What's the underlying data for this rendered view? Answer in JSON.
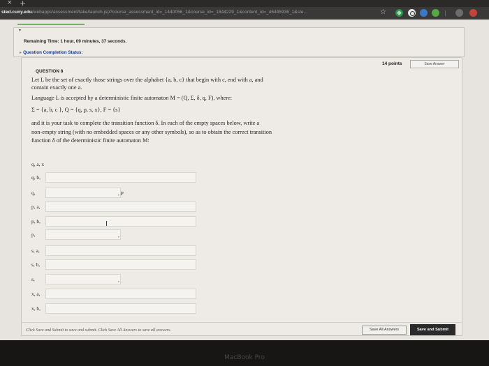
{
  "browser": {
    "tab_close_icon": "×",
    "new_tab_icon": "+",
    "url_host": "sted.cuny.edu",
    "url_path": "/webapps/assessment/take/launch.jsp?course_assessment_id=_1440056_1&course_id=_1844229_1&content_id=_46445936_1&ste...",
    "star_icon": "☆",
    "extension_icons": [
      "shield-check-icon",
      "circle-icon",
      "blue-extension-icon",
      "green-extension-icon",
      "profile-icon",
      "red-extension-icon"
    ]
  },
  "timer": {
    "label": "Remaining Time:",
    "value": "1 hour, 09 minutes, 37 seconds."
  },
  "completion_status": "Question Completion Status:",
  "question": {
    "heading": "QUESTION 8",
    "points": "14 points",
    "save_answer": "Save Answer",
    "line1": "Let L be the set of exactly those strings over the alphabet {a, b, c} that begin with  c,  end with a,  and",
    "line2": "contain exactly one    a.",
    "line3": "Language L is accepted by a deterministic finite automaton M = (Q, Σ, δ, q, F),  where:",
    "line4": "Σ = {a, b, c },  Q = {q, p, s, x},   F = {s}",
    "line5": "and it is your task to complete the transition function  δ.  In each of the empty spaces below, write a",
    "line6": "non-empty string (with no embedded spaces or any other symbols), so as to obtain the correct transition",
    "line7": "function  δ of the deterministic finite automaton M:",
    "transitions": [
      {
        "label": "q, a, x",
        "field": "none"
      },
      {
        "label": "q, b,",
        "field": "wide",
        "value": ""
      },
      {
        "label": "q,",
        "field": "narrow",
        "value": "",
        "extra": ", P"
      },
      {
        "label": "p, a,",
        "field": "wide",
        "value": ""
      },
      {
        "label": "p, b,",
        "field": "wide",
        "value": ""
      },
      {
        "label": "p,",
        "field": "narrow",
        "value": "",
        "extra": ","
      },
      {
        "label": "s, a,",
        "field": "wide",
        "value": ""
      },
      {
        "label": "s, b,",
        "field": "wide",
        "value": ""
      },
      {
        "label": "s,",
        "field": "narrow",
        "value": "",
        "extra": ","
      },
      {
        "label": "x, a,",
        "field": "wide",
        "value": ""
      },
      {
        "label": "x, b,",
        "field": "wide",
        "value": ""
      }
    ]
  },
  "footer": {
    "instructions": "Click Save and Submit to save and submit. Click Save All Answers to save all answers.",
    "save_all": "Save All Answers",
    "save_submit": "Save and Submit"
  },
  "device_label": "MacBook Pro"
}
